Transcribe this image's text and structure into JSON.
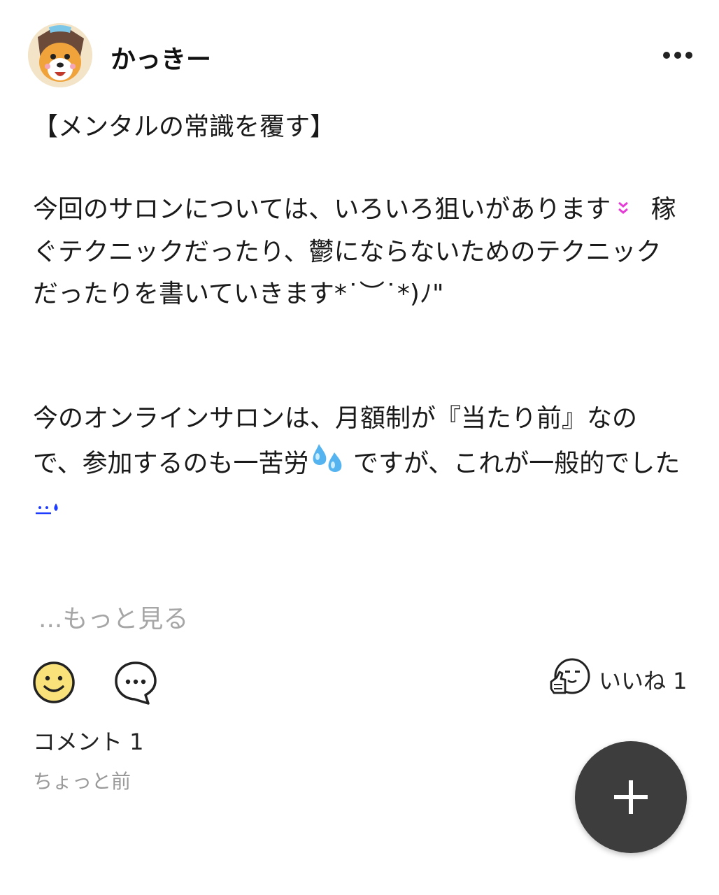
{
  "user": {
    "name": "かっきー"
  },
  "post": {
    "title": "【メンタルの常識を覆す】",
    "p1_a": "今回のサロンについては、いろいろ狙いがあります",
    "p1_b": " 稼ぐテクニックだったり、鬱にならないためのテクニックだったりを書いていきます*˙︶˙*)ﾉ\"",
    "p2_a": "今のオンラインサロンは、月額制が『当たり前』なので、参加するのも一苦労",
    "p2_b": "ですが、これが一般的でした"
  },
  "more_link": "...もっと見る",
  "actions": {
    "like_label": "いいね 1"
  },
  "comments": {
    "count_label": "コメント 1",
    "timestamp": "ちょっと前"
  },
  "colors": {
    "fab": "#3d3d3d",
    "muted_text": "#a6a6a6",
    "emoji_yellow": "#f9e27a"
  }
}
